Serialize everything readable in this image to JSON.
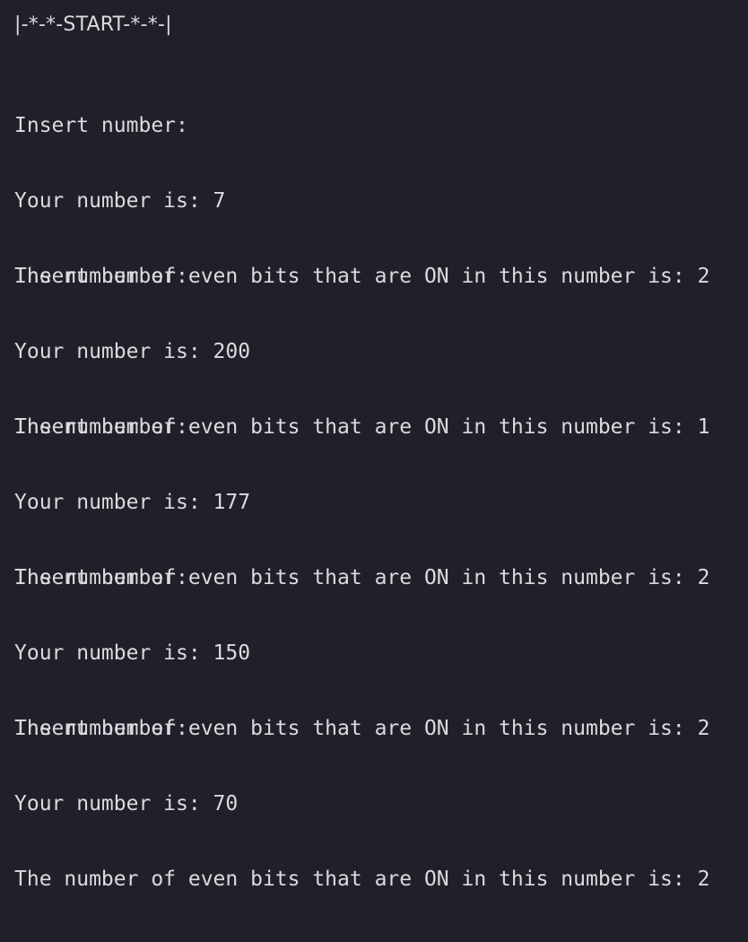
{
  "terminal": {
    "header": "|-*-*-START-*-*-|",
    "entries": [
      {
        "prompt": "Insert number:",
        "number_line": "Your number is: 7",
        "result_line": "The number of even bits that are ON in this number is: 2"
      },
      {
        "prompt": "Insert number:",
        "number_line": "Your number is: 200",
        "result_line": "The number of even bits that are ON in this number is: 1"
      },
      {
        "prompt": "Insert number:",
        "number_line": "Your number is: 177",
        "result_line": "The number of even bits that are ON in this number is: 2"
      },
      {
        "prompt": "Insert number:",
        "number_line": "Your number is: 150",
        "result_line": "The number of even bits that are ON in this number is: 2"
      },
      {
        "prompt": "Insert number:",
        "number_line": "Your number is: 70",
        "result_line": "The number of even bits that are ON in this number is: 2"
      }
    ]
  },
  "colors": {
    "background": "#1f2028",
    "text": "#d9dbe0"
  }
}
